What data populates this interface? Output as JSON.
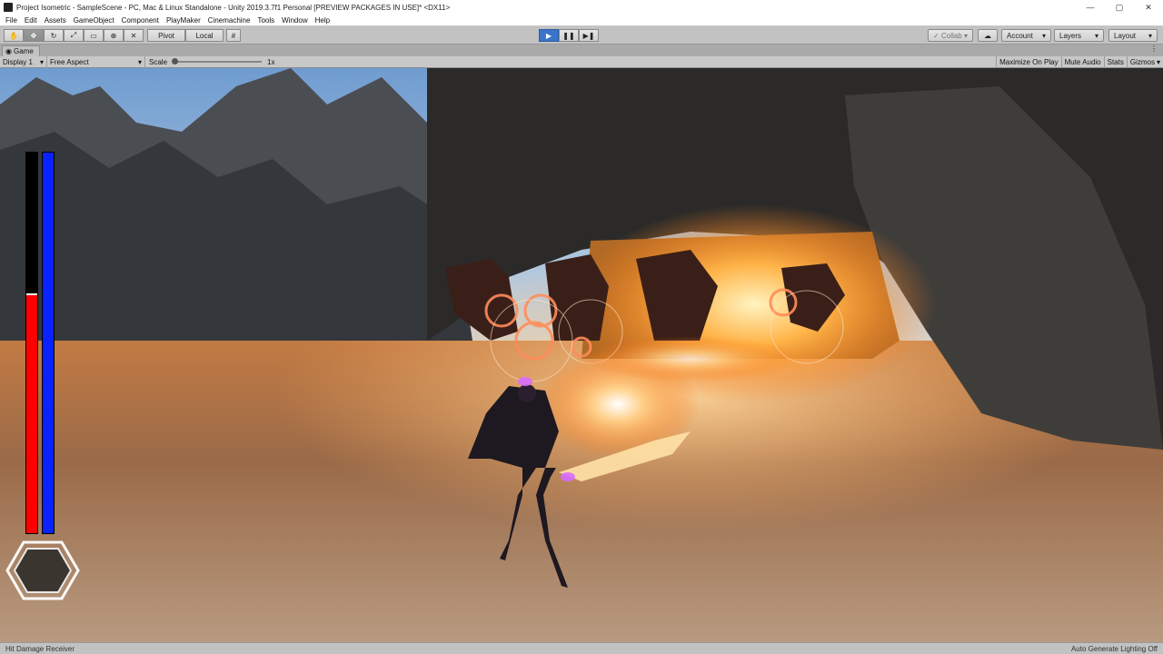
{
  "window": {
    "title": "Project Isometric - SampleScene - PC, Mac & Linux Standalone - Unity 2019.3.7f1 Personal [PREVIEW PACKAGES IN USE]* <DX11>",
    "controls": [
      "—",
      "▢",
      "✕"
    ]
  },
  "menu": [
    "File",
    "Edit",
    "Assets",
    "GameObject",
    "Component",
    "PlayMaker",
    "Cinemachine",
    "Tools",
    "Window",
    "Help"
  ],
  "toolbar": {
    "pivot_label": "Pivot",
    "local_label": "Local",
    "collab_label": "Collab",
    "account_label": "Account",
    "layers_label": "Layers",
    "layout_label": "Layout"
  },
  "tab": {
    "label": "Game"
  },
  "gamebar": {
    "display": "Display 1",
    "aspect": "Free Aspect",
    "scale_label": "Scale",
    "scale_value": "1x",
    "maximize": "Maximize On Play",
    "mute": "Mute Audio",
    "stats": "Stats",
    "gizmos": "Gizmos"
  },
  "hud": {
    "health_fraction": 0.63,
    "mana_fraction": 1.0,
    "health_color": "#ff0000",
    "mana_color": "#0a22ff"
  },
  "status": {
    "left": "Hit Damage Receiver",
    "right": "Auto Generate Lighting Off"
  }
}
